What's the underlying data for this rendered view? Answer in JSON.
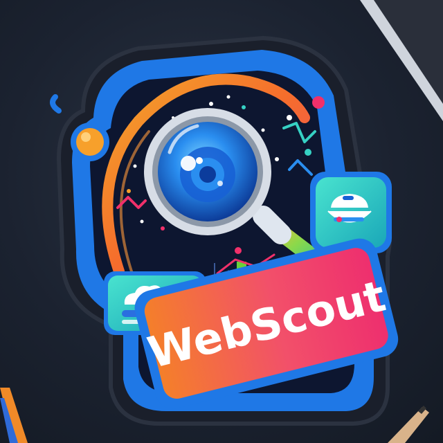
{
  "logo": {
    "name": "WebScout",
    "colors": {
      "background": "#1b2230",
      "sticker_outline": "#1e7ae6",
      "sticker_inner": "#0e1a3a",
      "banner_start": "#f4822a",
      "banner_end": "#f0306a",
      "accent_teal": "#36d1c4",
      "arc_orange": "#f7a02b",
      "lens_blue": "#2a8ef0"
    },
    "icons": [
      "magnifier-icon",
      "line-chart-icon",
      "bar-chart-icon",
      "cloud-card-icon",
      "dashboard-card-icon"
    ]
  }
}
